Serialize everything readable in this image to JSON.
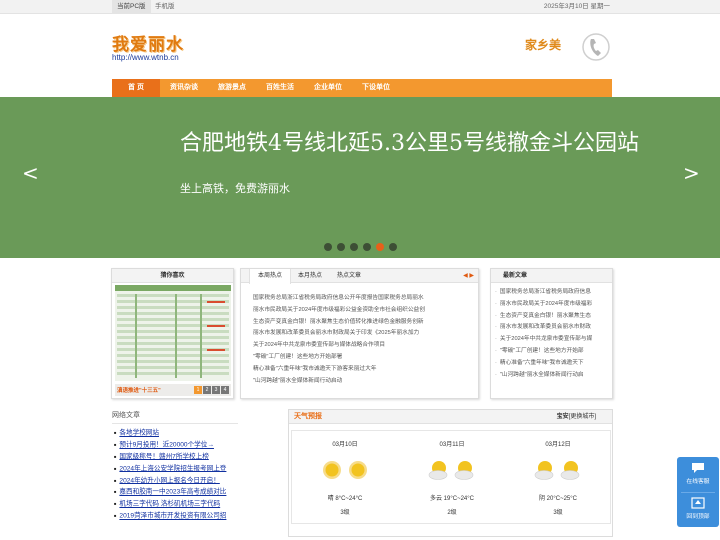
{
  "topbar": {
    "pc_label": "当前PC版",
    "mobile_label": "手机版",
    "date": "2025年3月10日 星期一"
  },
  "header": {
    "logo_title": "我爱丽水",
    "logo_url": "http://www.wtnb.cn",
    "hotline_text": "家乡美",
    "hotline_icon": "phone-icon"
  },
  "nav": {
    "items": [
      {
        "label": "首 页",
        "active": true
      },
      {
        "label": "资讯杂谈",
        "active": false
      },
      {
        "label": "旅游景点",
        "active": false
      },
      {
        "label": "百姓生活",
        "active": false
      },
      {
        "label": "企业单位",
        "active": false
      },
      {
        "label": "下设单位",
        "active": false
      }
    ]
  },
  "banner": {
    "headline": "合肥地铁4号线北延5.3公里5号线撤金斗公园站",
    "subtitle": "坐上高铁，免费游丽水",
    "prev": "<",
    "next": ">",
    "dot_count": 6,
    "active_dot": 5,
    "bg_color": "#6a9a58"
  },
  "gallery": {
    "title": "猜你喜欢",
    "caption": "滇语推进\"十三五\"",
    "pages": [
      "1",
      "2",
      "3",
      "4"
    ],
    "active_page": 0
  },
  "news_tabs": {
    "tabs": [
      "本周热点",
      "本月热点",
      "热点文章"
    ],
    "active": 0,
    "arrows": "◀ ▶",
    "items": [
      "国家税务总局浙江省税务局政府信息公开年度报告国家税务总局丽水",
      "丽水市民政局关于2024年度市级福彩公益金资助全市社会组织公益创",
      "生态资产变真金白银！丽水聚焦生态价值转化推进绿色金融服务创新",
      "丽水市发展和改革委员会丽水市财政局关于印发《2025年丽水加力",
      "关于2024年中共龙泉市委宣传部与媒体战略合作项目",
      "\"零碳\"工厂创建！这些地方开始部署",
      "精心准备\"六重年味\"我市诚邀天下游客来丽过大年",
      "\"山河跨越\"丽水全媒体新闻行动启动"
    ]
  },
  "latest": {
    "title": "最新文章",
    "items": [
      "国家税务总局浙江省税务局政府信息",
      "丽水市民政局关于2024年度市级福彩",
      "生态资产变真金白银！丽水聚焦生态",
      "丽水市发展和改革委员会丽水市财政",
      "关于2024年中共龙泉市委宣传部与媒",
      "\"零碳\"工厂创建！这些地方开始部",
      "精心准备\"六重年味\"我市诚邀天下",
      "\"山河跨越\"丽水全媒体新闻行动启"
    ]
  },
  "weblinks": {
    "title": "网络文章",
    "items": [
      "各地学校网站",
      "预计9月投用！近20000个学位→",
      "国家级称号！赣州7所学校上榜",
      "2024年上海公安学院招生报考网上登",
      "2024年幼升小网上报名今日开启！",
      "嘉西和胶南一中2023年高考成绩对比",
      "机场三字代码 洛杉矶机场三字代码",
      "2019菏泽市城市开发投资有限公司招"
    ]
  },
  "weather": {
    "title": "天气预报",
    "city_label": "宝安",
    "change_city": "[更换城市]",
    "days": [
      {
        "date": "03月10日",
        "desc": "晴 8°C~24°C",
        "level": "3级",
        "icons": [
          "sun-icon",
          "sun-icon"
        ]
      },
      {
        "date": "03月11日",
        "desc": "多云 19°C~24°C",
        "level": "2级",
        "icons": [
          "cloud-sun-icon",
          "cloud-sun-icon"
        ]
      },
      {
        "date": "03月12日",
        "desc": "阴 20°C~25°C",
        "level": "3级",
        "icons": [
          "cloud-sun-icon",
          "cloud-sun-icon"
        ]
      }
    ]
  },
  "float": {
    "consult_label": "在线客服",
    "top_label": "回到顶部"
  }
}
